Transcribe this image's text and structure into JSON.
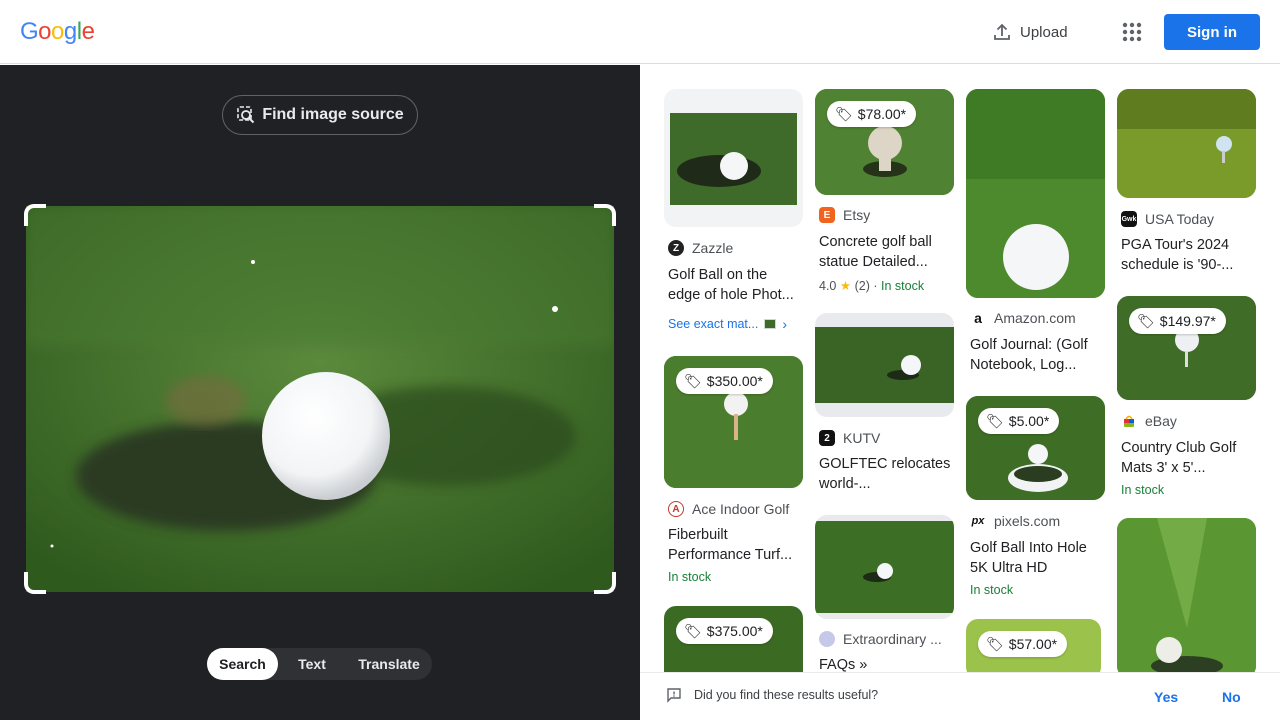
{
  "header": {
    "logo_letters": [
      "G",
      "o",
      "o",
      "g",
      "l",
      "e"
    ],
    "logo_colors": [
      "#4285f4",
      "#ea4335",
      "#fbbc05",
      "#4285f4",
      "#34a853",
      "#ea4335"
    ],
    "upload_label": "Upload",
    "apps_icon": "apps-grid-icon",
    "signin_label": "Sign in"
  },
  "left": {
    "find_source_label": "Find image source",
    "modes": [
      "Search",
      "Text",
      "Translate"
    ],
    "active_mode": "Search"
  },
  "results": [
    {
      "source": "Zazzle",
      "title": "Golf Ball on the edge of hole Phot...",
      "exact_match": "See exact mat..."
    },
    {
      "price": "$350.00*",
      "source": "Ace Indoor Golf",
      "title": "Fiberbuilt Performance Turf...",
      "stock": "In stock"
    },
    {
      "price": "$375.00*"
    },
    {
      "price": "$78.00*",
      "source": "Etsy",
      "title": "Concrete golf ball statue Detailed...",
      "rating": "4.0",
      "rating_count": "(2)",
      "stock": "In stock"
    },
    {
      "source": "KUTV",
      "title": "GOLFTEC relocates world-..."
    },
    {
      "source": "Extraordinary ...",
      "title": "FAQs »"
    },
    {
      "source": "Amazon.com",
      "title": "Golf Journal: (Golf Notebook, Log..."
    },
    {
      "price": "$5.00*",
      "source": "pixels.com",
      "title": "Golf Ball Into Hole 5K Ultra HD",
      "stock": "In stock"
    },
    {
      "price": "$57.00*"
    },
    {
      "source": "USA Today",
      "title": "PGA Tour's 2024 schedule is '90-..."
    },
    {
      "price": "$149.97*",
      "source": "eBay",
      "title": "Country Club Golf Mats 3' x 5'...",
      "stock": "In stock"
    }
  ],
  "feedback": {
    "question": "Did you find these results useful?",
    "yes_label": "Yes",
    "no_label": "No"
  }
}
